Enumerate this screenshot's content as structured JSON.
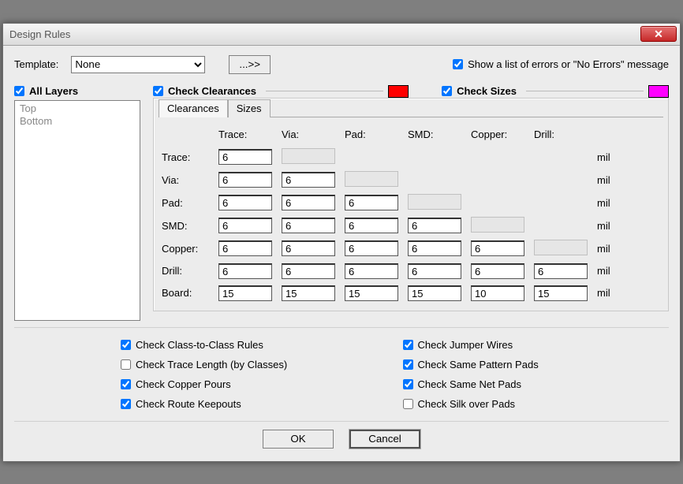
{
  "window_title": "Design Rules",
  "template_label": "Template:",
  "template_value": "None",
  "more_button": "...>>",
  "show_errors_label": "Show a list of errors or \"No Errors\" message",
  "show_errors_checked": true,
  "all_layers_label": "All Layers",
  "all_layers_checked": true,
  "layers": [
    "Top",
    "Bottom"
  ],
  "check_clearances_label": "Check Clearances",
  "check_clearances_checked": true,
  "clearances_color": "#ff0000",
  "check_sizes_label": "Check Sizes",
  "check_sizes_checked": true,
  "sizes_color": "#ff00ff",
  "tabs": {
    "clearances": "Clearances",
    "sizes": "Sizes",
    "active": "clearances"
  },
  "cols": [
    "Trace:",
    "Via:",
    "Pad:",
    "SMD:",
    "Copper:",
    "Drill:"
  ],
  "rows": [
    "Trace:",
    "Via:",
    "Pad:",
    "SMD:",
    "Copper:",
    "Drill:",
    "Board:"
  ],
  "unit": "mil",
  "grid": {
    "Trace": [
      "6",
      null,
      null,
      null,
      null,
      null
    ],
    "Via": [
      "6",
      "6",
      null,
      null,
      null,
      null
    ],
    "Pad": [
      "6",
      "6",
      "6",
      null,
      null,
      null
    ],
    "SMD": [
      "6",
      "6",
      "6",
      "6",
      null,
      null
    ],
    "Copper": [
      "6",
      "6",
      "6",
      "6",
      "6",
      null
    ],
    "Drill": [
      "6",
      "6",
      "6",
      "6",
      "6",
      "6"
    ],
    "Board": [
      "15",
      "15",
      "15",
      "15",
      "10",
      "15"
    ]
  },
  "checks": {
    "class_to_class": {
      "label": "Check Class-to-Class Rules",
      "checked": true
    },
    "jumper_wires": {
      "label": "Check Jumper Wires",
      "checked": true
    },
    "trace_length": {
      "label": "Check Trace Length (by Classes)",
      "checked": false
    },
    "same_pattern": {
      "label": "Check Same Pattern Pads",
      "checked": true
    },
    "copper_pours": {
      "label": "Check Copper Pours",
      "checked": true
    },
    "same_net": {
      "label": "Check Same Net Pads",
      "checked": true
    },
    "route_keepouts": {
      "label": "Check Route Keepouts",
      "checked": true
    },
    "silk_over_pads": {
      "label": "Check Silk over Pads",
      "checked": false
    }
  },
  "ok_label": "OK",
  "cancel_label": "Cancel"
}
